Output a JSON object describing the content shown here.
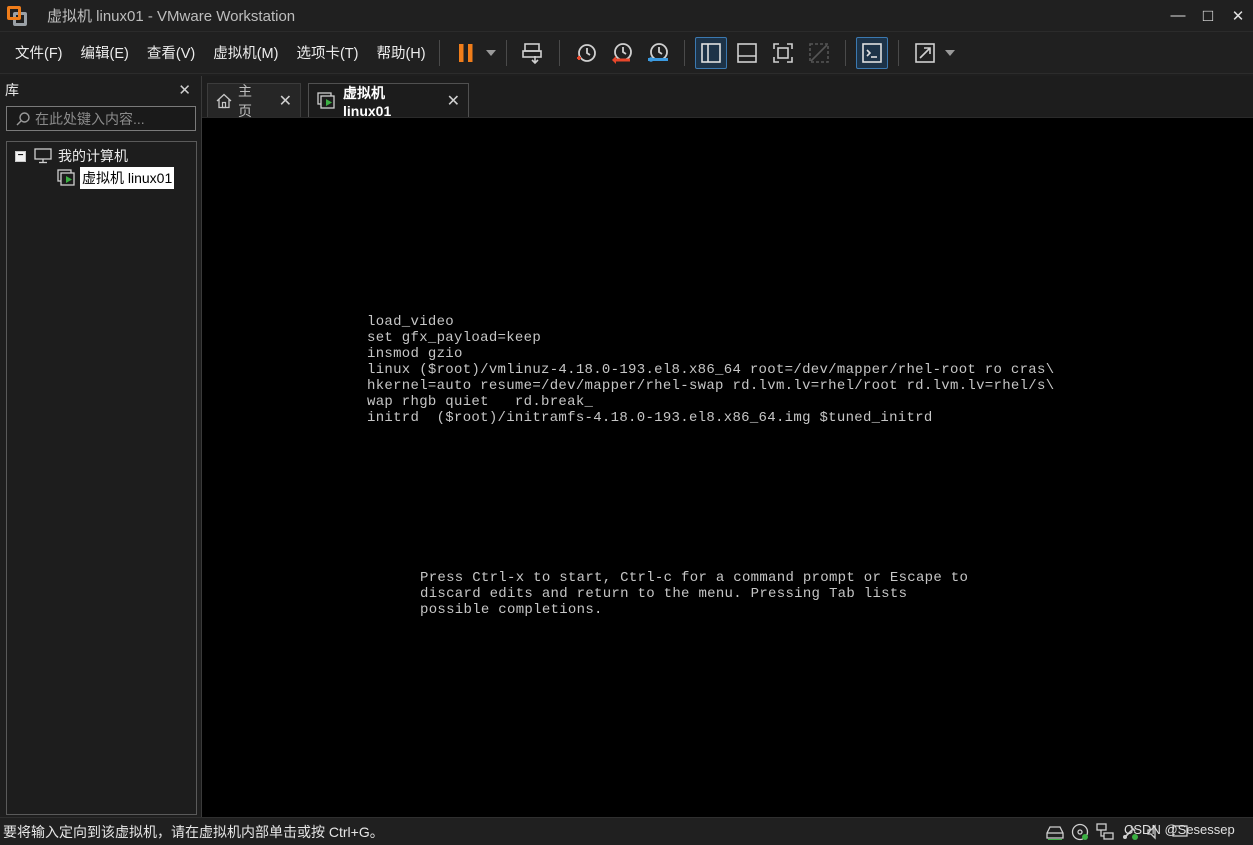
{
  "window": {
    "title": "虚拟机 linux01 - VMware Workstation",
    "minimize": "—",
    "maximize": "□",
    "close": "✕"
  },
  "menu": [
    "文件(F)",
    "编辑(E)",
    "查看(V)",
    "虚拟机(M)",
    "选项卡(T)",
    "帮助(H)"
  ],
  "library": {
    "title": "库",
    "close": "✕",
    "search_placeholder": "在此处键入内容...",
    "tree": {
      "root_label": "我的计算机",
      "root_toggle": "−",
      "child_label": "虚拟机 linux01"
    }
  },
  "tabs": [
    {
      "label": "主页",
      "close": "✕"
    },
    {
      "label": "虚拟机 linux01",
      "close": "✕"
    }
  ],
  "console": {
    "boot_lines": [
      "load_video",
      "set gfx_payload=keep",
      "insmod gzio",
      "linux ($root)/vmlinuz-4.18.0-193.el8.x86_64 root=/dev/mapper/rhel-root ro cras\\",
      "hkernel=auto resume=/dev/mapper/rhel-swap rd.lvm.lv=rhel/root rd.lvm.lv=rhel/s\\",
      "wap rhgb quiet   rd.break_",
      "initrd  ($root)/initramfs-4.18.0-193.el8.x86_64.img $tuned_initrd"
    ],
    "help_lines": [
      "Press Ctrl-x to start, Ctrl-c for a command prompt or Escape to",
      "discard edits and return to the menu. Pressing Tab lists",
      "possible completions."
    ]
  },
  "status": {
    "message": "要将输入定向到该虚拟机，请在虚拟机内部单击或按 Ctrl+G。",
    "watermark": "CSDN @Sesessep"
  },
  "colors": {
    "accent_orange": "#f07d1a",
    "accent_red": "#e8472b",
    "accent_blue": "#3b9ae0",
    "vm_green": "#3cb043"
  },
  "icons": {
    "toolbar": [
      "pause-icon",
      "send-keys-icon",
      "snapshot-icon",
      "revert-snapshot-icon",
      "snapshot-manager-icon",
      "library-view-icon",
      "thumbnail-view-icon",
      "fullscreen-icon",
      "unity-icon",
      "console-view-icon",
      "stretch-icon"
    ],
    "status": [
      "hdd-icon",
      "cdrom-icon",
      "network-icon",
      "usb-icon",
      "sound-icon",
      "display-icon"
    ]
  }
}
